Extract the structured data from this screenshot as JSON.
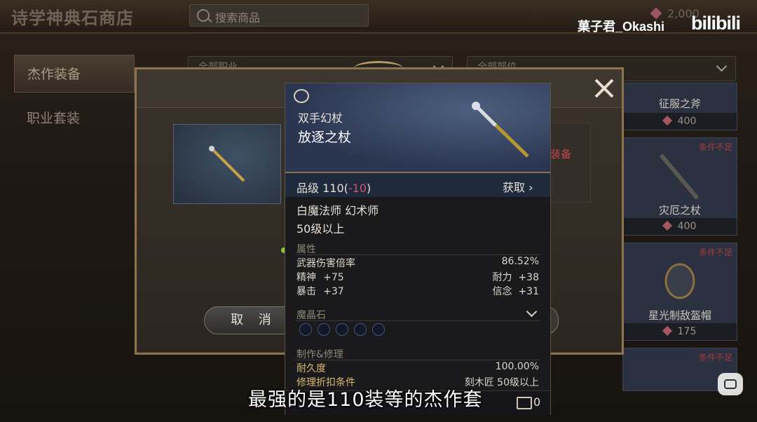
{
  "window": {
    "title": "诗学神典石商店"
  },
  "search": {
    "placeholder": "搜索商品"
  },
  "currency": {
    "top_value": "2,000"
  },
  "watermark": {
    "uploader": "菓子君_Okashi",
    "logo": "bilibili"
  },
  "sidebar": {
    "items": [
      {
        "label": "杰作装备",
        "selected": true
      },
      {
        "label": "职业套装",
        "selected": false
      }
    ]
  },
  "filters": {
    "job": "全部职业",
    "part": "全部部位"
  },
  "shop_cards": [
    {
      "name": "征服之斧",
      "price": "400",
      "condition": ""
    },
    {
      "name": "灾厄之杖",
      "price": "400",
      "condition": "条件不足"
    },
    {
      "name": "星光制敌盔帽",
      "price": "175",
      "condition": "条件不足"
    },
    {
      "name": "",
      "price": "",
      "condition": "条件不足"
    }
  ],
  "dialog": {
    "partial_label": "装备",
    "cancel_label": "取 消",
    "below_condition": "条件不足"
  },
  "tooltip": {
    "item_type": "双手幻杖",
    "item_name": "放逐之杖",
    "item_level_label": "品级 110",
    "item_level_delta": "-10",
    "acquire_label": "获取",
    "jobs": "白魔法师  幻术师",
    "level_req": "50级以上",
    "attributes_title": "属性",
    "attributes": [
      {
        "left_label": "武器伤害倍率",
        "left_value": "",
        "right_label": "",
        "right_value": "86.52%"
      },
      {
        "left_label": "精神",
        "left_value": "+75",
        "right_label": "耐力",
        "right_value": "+38"
      },
      {
        "left_label": "暴击",
        "left_value": "+37",
        "right_label": "信念",
        "right_value": "+31"
      }
    ],
    "materia_title": "魔晶石",
    "materia_slots": 5,
    "craft_title": "制作&修理",
    "durability_label": "耐久度",
    "durability_value": "100.00%",
    "repair_label": "修理折扣条件",
    "repair_value": "刻木匠 50级以上",
    "bag_count": "0"
  },
  "subtitle": "最强的是110装等的杰作套",
  "colors": {
    "accent_gold": "#8a7550",
    "negative": "#d05468",
    "condition_red": "#a13c3c"
  }
}
